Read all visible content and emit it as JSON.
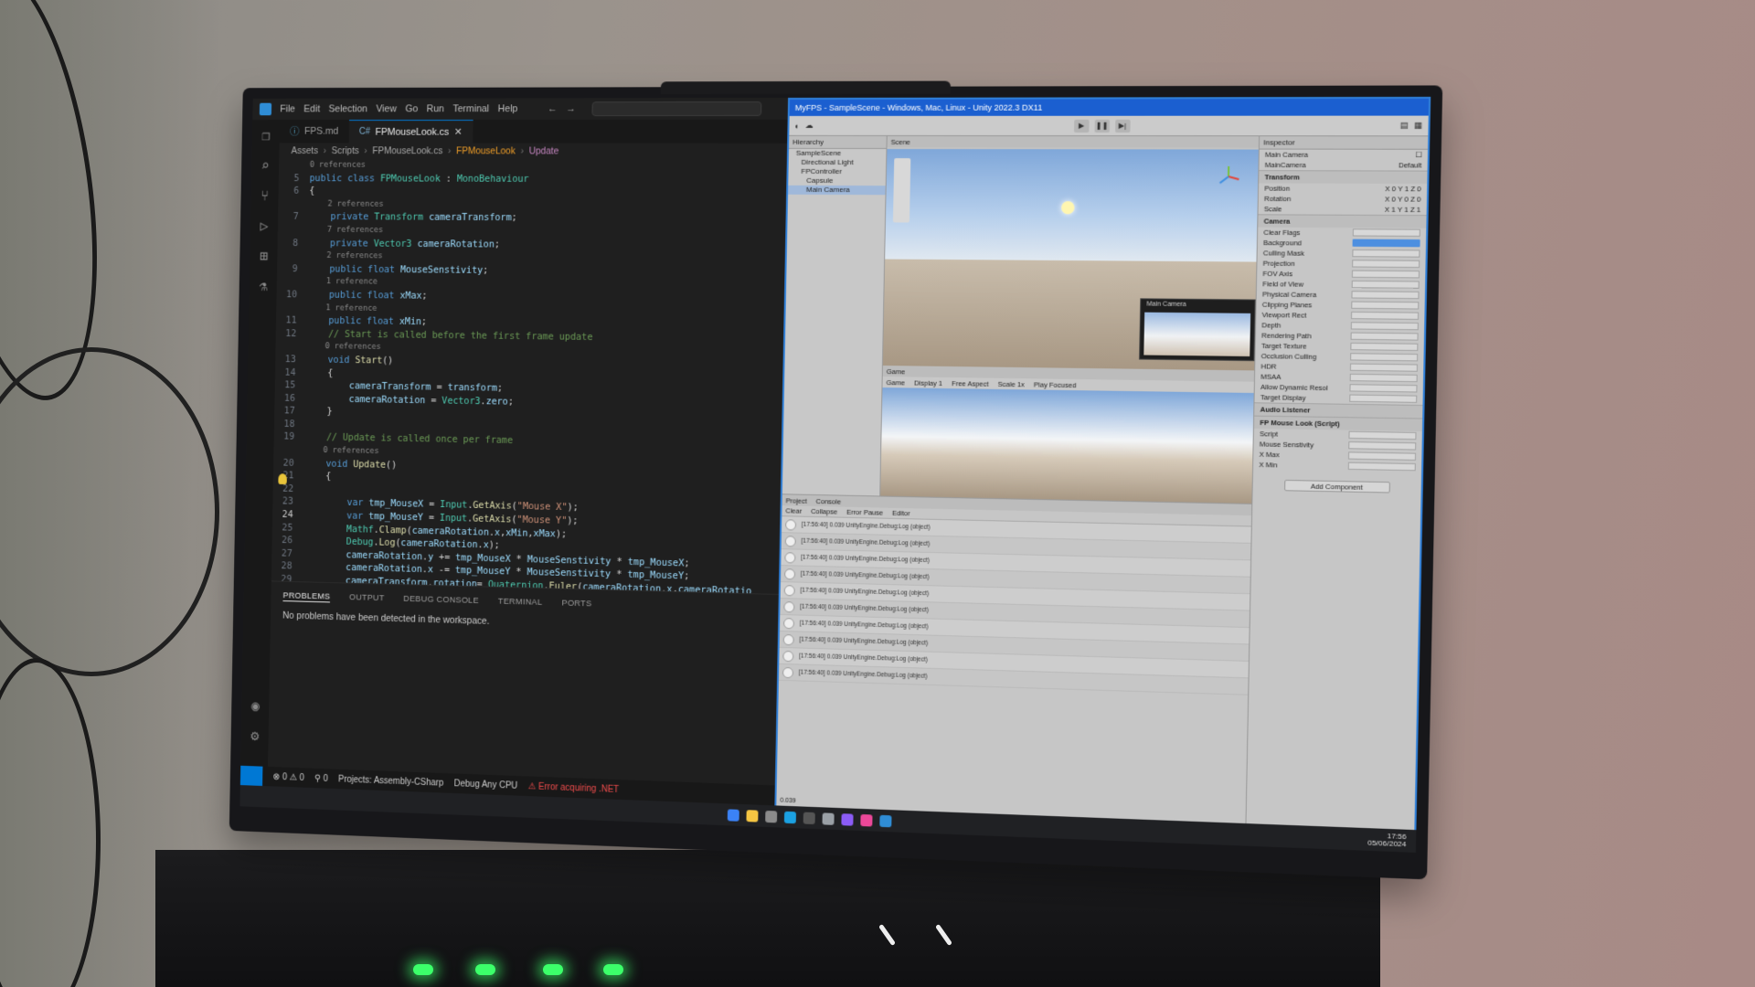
{
  "vscode": {
    "menu": [
      "File",
      "Edit",
      "Selection",
      "View",
      "Go",
      "Run",
      "Terminal",
      "Help"
    ],
    "tabs": [
      {
        "label": "FPS.md",
        "active": false
      },
      {
        "label": "FPMouseLook.cs",
        "active": true
      }
    ],
    "breadcrumb": [
      "Assets",
      "Scripts",
      "FPMouseLook.cs",
      "FPMouseLook",
      "Update"
    ],
    "code_lines": [
      {
        "n": "",
        "text": "0 references",
        "lens": true
      },
      {
        "n": "5",
        "text": "public class FPMouseLook : MonoBehaviour"
      },
      {
        "n": "6",
        "text": "{"
      },
      {
        "n": "",
        "text": "    2 references",
        "lens": true
      },
      {
        "n": "7",
        "text": "    private Transform cameraTransform;"
      },
      {
        "n": "",
        "text": "    7 references",
        "lens": true
      },
      {
        "n": "8",
        "text": "    private Vector3 cameraRotation;"
      },
      {
        "n": "",
        "text": "    2 references",
        "lens": true
      },
      {
        "n": "9",
        "text": "    public float MouseSenstivity;"
      },
      {
        "n": "",
        "text": "    1 reference",
        "lens": true
      },
      {
        "n": "10",
        "text": "    public float xMax;"
      },
      {
        "n": "",
        "text": "    1 reference",
        "lens": true
      },
      {
        "n": "11",
        "text": "    public float xMin;"
      },
      {
        "n": "12",
        "text": "    // Start is called before the first frame update"
      },
      {
        "n": "",
        "text": "    0 references",
        "lens": true
      },
      {
        "n": "13",
        "text": "    void Start()"
      },
      {
        "n": "14",
        "text": "    {"
      },
      {
        "n": "15",
        "text": "        cameraTransform = transform;"
      },
      {
        "n": "16",
        "text": "        cameraRotation = Vector3.zero;"
      },
      {
        "n": "17",
        "text": "    }"
      },
      {
        "n": "18",
        "text": ""
      },
      {
        "n": "19",
        "text": "    // Update is called once per frame"
      },
      {
        "n": "",
        "text": "    0 references",
        "lens": true
      },
      {
        "n": "20",
        "text": "    void Update()"
      },
      {
        "n": "21",
        "text": "    {"
      },
      {
        "n": "22",
        "text": ""
      },
      {
        "n": "23",
        "text": "        var tmp_MouseX = Input.GetAxis(\"Mouse X\");"
      },
      {
        "n": "24",
        "text": "        var tmp_MouseY = Input.GetAxis(\"Mouse Y\");"
      },
      {
        "n": "25",
        "text": "        Mathf.Clamp(cameraRotation.x,xMin,xMax);"
      },
      {
        "n": "26",
        "text": "        Debug.Log(cameraRotation.x);"
      },
      {
        "n": "27",
        "text": "        cameraRotation.y += tmp_MouseX * MouseSenstivity * tmp_MouseX;"
      },
      {
        "n": "28",
        "text": "        cameraRotation.x -= tmp_MouseY * MouseSenstivity * tmp_MouseY;"
      },
      {
        "n": "29",
        "text": "        cameraTransform.rotation= Quaternion.Euler(cameraRotation.x,cameraRotatio"
      },
      {
        "n": "30",
        "text": "    }"
      },
      {
        "n": "31",
        "text": "}"
      },
      {
        "n": "32",
        "text": ""
      }
    ],
    "panel_tabs": [
      "PROBLEMS",
      "OUTPUT",
      "DEBUG CONSOLE",
      "TERMINAL",
      "PORTS"
    ],
    "panel_message": "No problems have been detected in the workspace.",
    "status": {
      "errors": "0",
      "warnings": "0",
      "ports": "0",
      "project": "Projects: Assembly-CSharp",
      "config": "Debug Any CPU",
      "error_text": "Error acquiring .NET"
    }
  },
  "unity": {
    "title": "MyFPS - SampleScene - Windows, Mac, Linux - Unity 2022.3 DX11",
    "hierarchy_title": "Hierarchy",
    "hierarchy_items": [
      "SampleScene",
      "Directional Light",
      "FPController",
      "Capsule",
      "Main Camera"
    ],
    "scene_tab": "Scene",
    "game_tab": "Game",
    "game_toolbar": [
      "Game",
      "Display 1",
      "Free Aspect",
      "Scale 1x",
      "Play Focused"
    ],
    "camera_preview_label": "Main Camera",
    "inspector_title": "Inspector",
    "inspector_object": "Main Camera",
    "inspector_tag": "MainCamera",
    "inspector_layer": "Default",
    "components": [
      "Transform",
      "Camera",
      "Audio Listener",
      "FP Mouse Look (Script)"
    ],
    "camera_fields": [
      "Clear Flags",
      "Background",
      "Culling Mask",
      "Projection",
      "FOV Axis",
      "Field of View",
      "Physical Camera",
      "Clipping Planes",
      "Viewport Rect",
      "Depth",
      "Rendering Path",
      "Target Texture",
      "Occlusion Culling",
      "HDR",
      "MSAA",
      "Allow Dynamic Resol",
      "Target Display"
    ],
    "script_fields": [
      "Script",
      "Mouse Senstivity",
      "X Max",
      "X Min"
    ],
    "add_component": "Add Component",
    "console_tabs": [
      "Project",
      "Console"
    ],
    "console_toolbar": [
      "Clear",
      "Collapse",
      "Error Pause",
      "Editor"
    ],
    "log_entries": [
      "[17:56:40] 0.039 UnityEngine.Debug:Log (object)",
      "[17:56:40] 0.039 UnityEngine.Debug:Log (object)",
      "[17:56:40] 0.039 UnityEngine.Debug:Log (object)",
      "[17:56:40] 0.039 UnityEngine.Debug:Log (object)",
      "[17:56:40] 0.039 UnityEngine.Debug:Log (object)",
      "[17:56:40] 0.039 UnityEngine.Debug:Log (object)",
      "[17:56:40] 0.039 UnityEngine.Debug:Log (object)",
      "[17:56:40] 0.039 UnityEngine.Debug:Log (object)",
      "[17:56:40] 0.039 UnityEngine.Debug:Log (object)",
      "[17:56:40] 0.039 UnityEngine.Debug:Log (object)"
    ],
    "status_text": "0.039"
  },
  "taskbar": {
    "time": "17:56",
    "date": "05/06/2024",
    "icon_colors": [
      "#3b82f6",
      "#f5c542",
      "#8b8b8b",
      "#1ba1e2",
      "#555555",
      "#9aa0a6",
      "#8b5cf6",
      "#ec4899",
      "#2f8dd6"
    ]
  },
  "colors": {
    "keyword": "#569cd6",
    "type": "#4ec9b0",
    "method": "#dcdcaa",
    "string": "#ce9178",
    "comment": "#6a9955",
    "field": "#9cdcfe",
    "accent": "#0078d4",
    "unity_title": "#1b5fd0"
  }
}
